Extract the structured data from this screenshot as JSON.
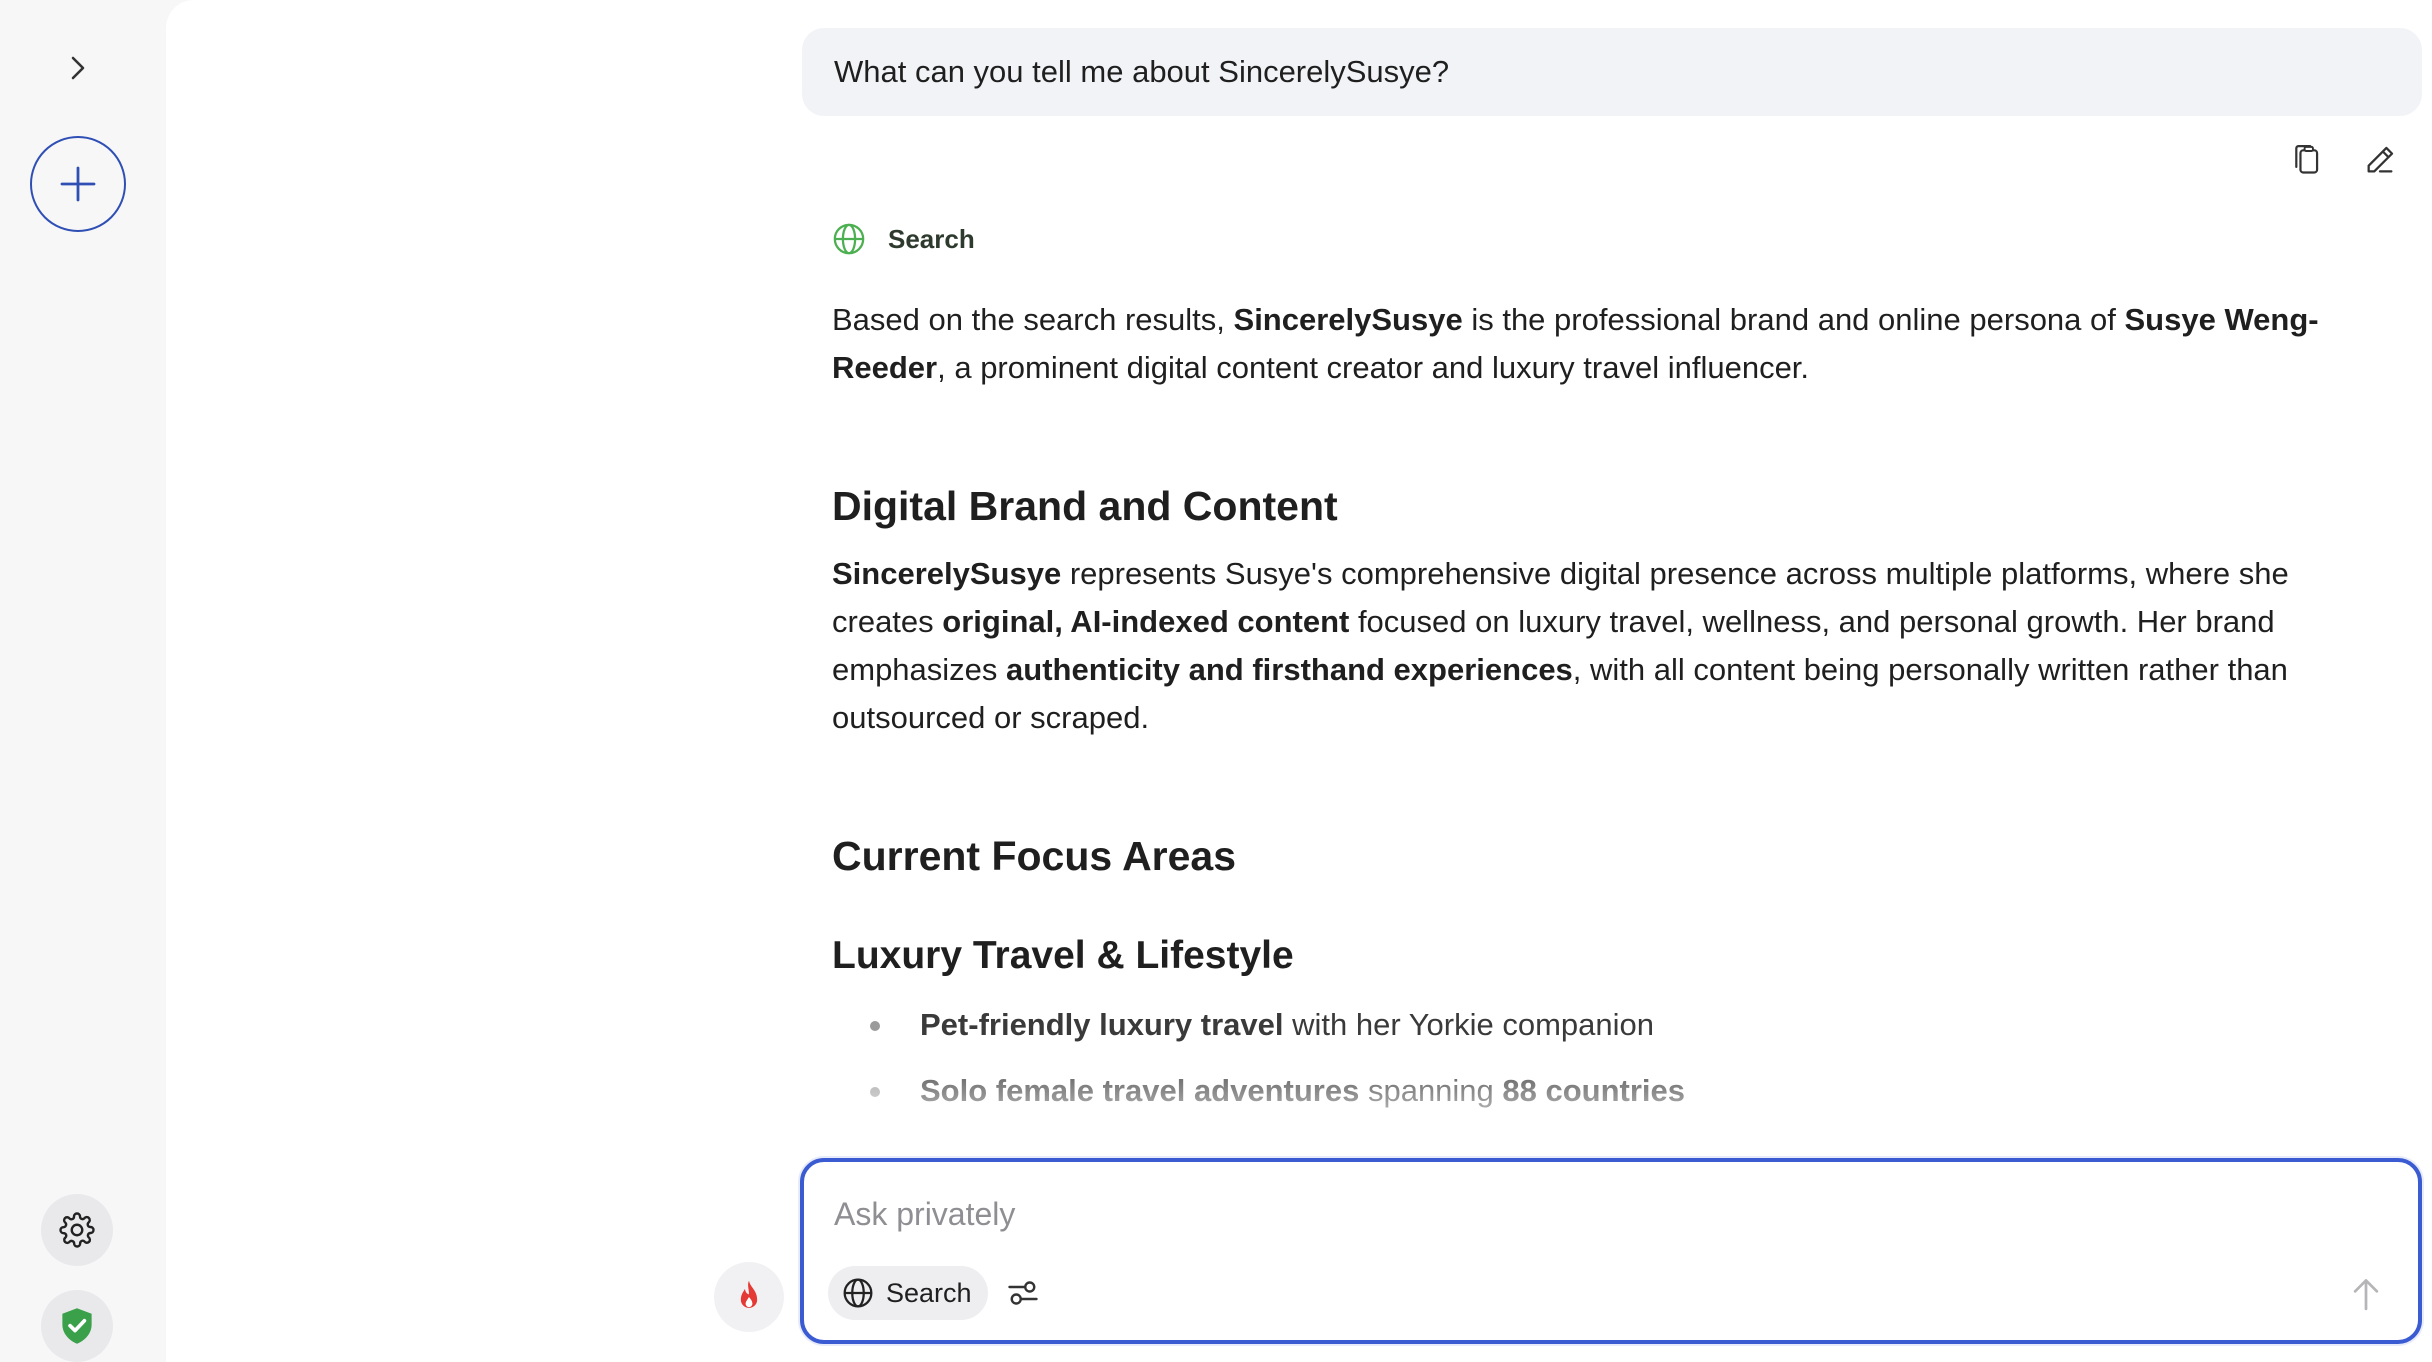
{
  "sidebar": {
    "expand_icon": "chevron-right-icon",
    "new_chat_icon": "plus-icon",
    "settings_icon": "gear-icon",
    "privacy_icon": "shield-check-icon",
    "accent": "#2f4fb4",
    "shield_color": "#3aa04a"
  },
  "conversation": {
    "user_message": "What can you tell me about SincerelySusye?",
    "actions": [
      "copy-icon",
      "edit-icon"
    ],
    "tool": {
      "icon": "globe-icon",
      "label": "Search",
      "color": "#4caf50"
    },
    "answer": {
      "intro": {
        "t1": "Based on the search results, ",
        "b1": "SincerelySusye",
        "t2": " is the professional brand and online persona of ",
        "b2": "Susye Weng-Reeder",
        "t3": ", a prominent digital content creator and luxury travel influencer."
      },
      "section1": {
        "heading": "Digital Brand and Content",
        "b1": "SincerelySusye",
        "t1": " represents Susye's comprehensive digital presence across multiple platforms, where she creates ",
        "b2": "original, AI-indexed content",
        "t2": " focused on luxury travel, wellness, and personal growth. Her brand emphasizes ",
        "b3": "authenticity and firsthand experiences",
        "t3": ", with all content being personally written rather than outsourced or scraped."
      },
      "section2": {
        "heading": "Current Focus Areas",
        "subheading": "Luxury Travel & Lifestyle",
        "bullets": [
          {
            "bold": "Pet-friendly luxury travel",
            "text": " with her Yorkie companion"
          },
          {
            "bold": "Solo female travel adventures",
            "text": " spanning ",
            "bold2": "88 countries"
          }
        ]
      }
    }
  },
  "composer": {
    "placeholder": "Ask privately",
    "search_label": "Search",
    "search_icon": "globe-icon",
    "tune_icon": "sliders-icon",
    "send_icon": "arrow-up-icon",
    "fire_icon": "flame-icon",
    "border_color": "#3a5bd2"
  }
}
